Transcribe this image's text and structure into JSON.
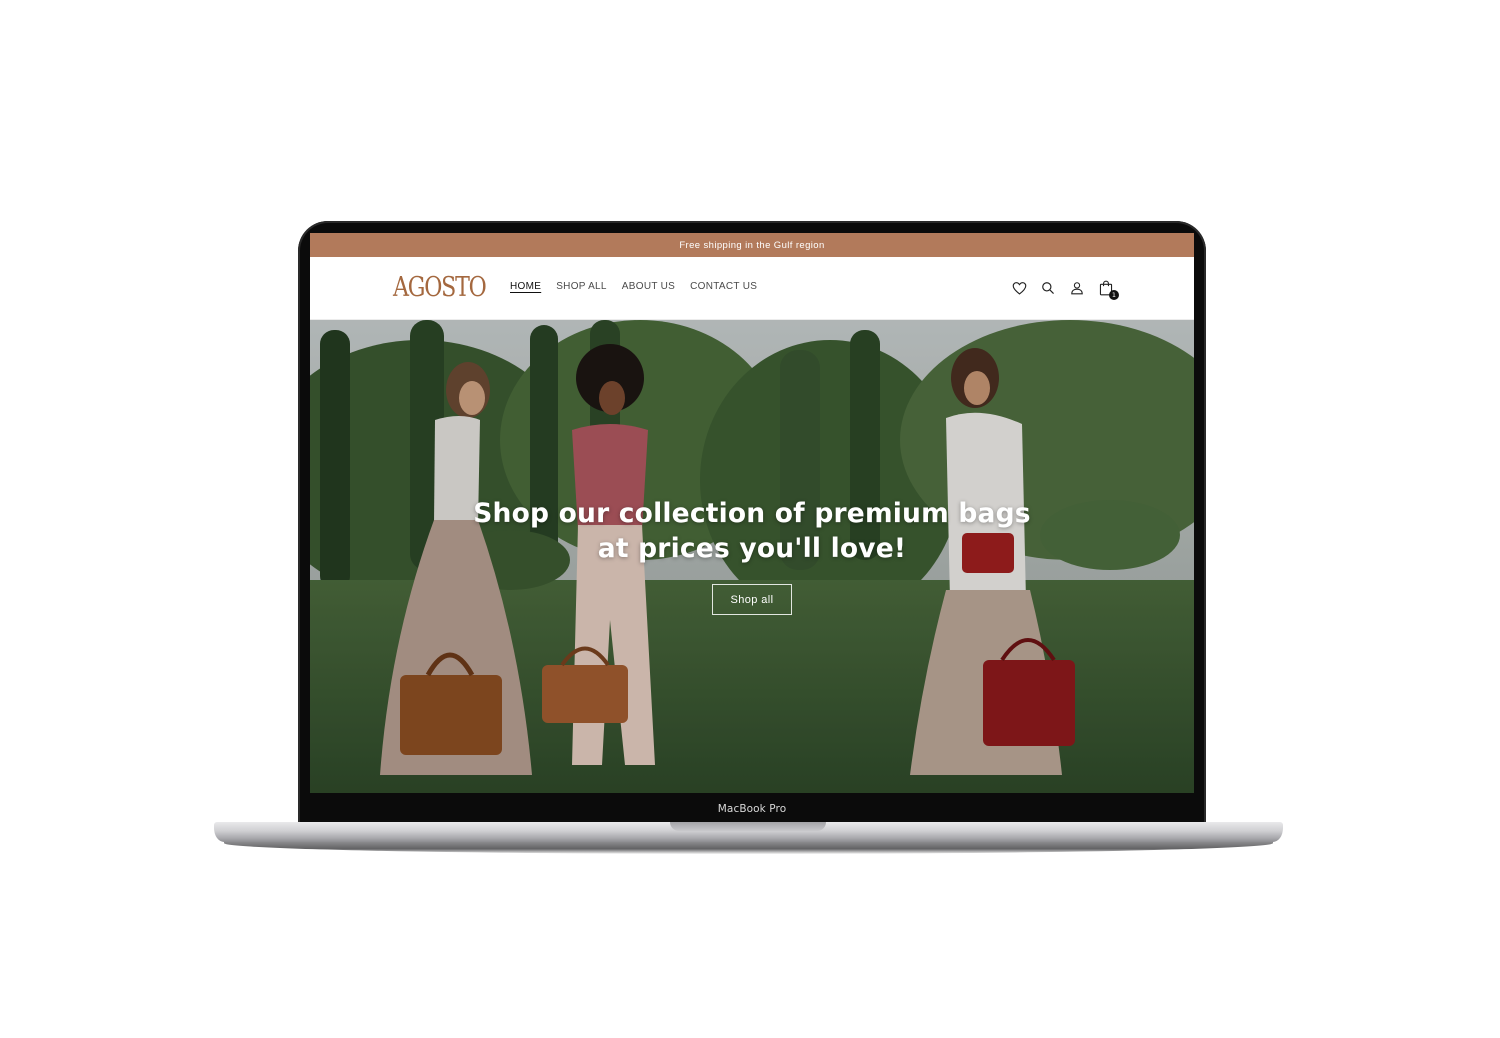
{
  "device": {
    "label": "MacBook Pro"
  },
  "announcement": {
    "text": "Free shipping in the Gulf region",
    "background": "#b27a5b"
  },
  "brand": {
    "logo_text": "AGOSTO",
    "color": "#a4683f"
  },
  "nav": {
    "items": [
      {
        "label": "HOME",
        "active": true
      },
      {
        "label": "SHOP ALL",
        "active": false
      },
      {
        "label": "ABOUT US",
        "active": false
      },
      {
        "label": "CONTACT US",
        "active": false
      }
    ]
  },
  "header_icons": {
    "wishlist": "heart-icon",
    "search": "search-icon",
    "account": "user-icon",
    "cart": "shopping-bag-icon",
    "cart_count": "1"
  },
  "hero": {
    "heading_line1": "Shop our collection of premium bags",
    "heading_line2": "at prices you'll love!",
    "button_label": "Shop all"
  }
}
